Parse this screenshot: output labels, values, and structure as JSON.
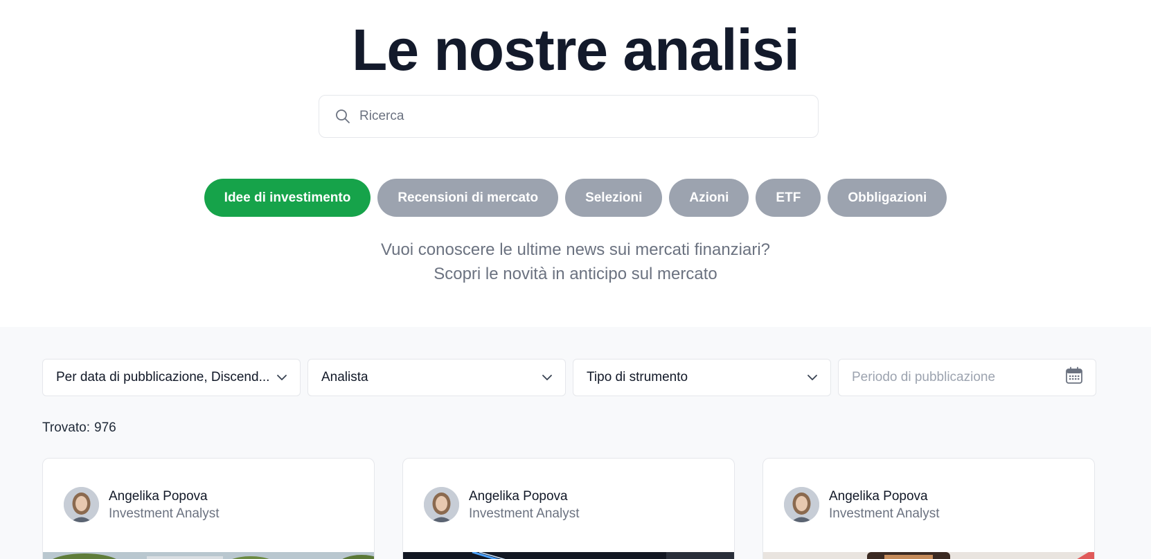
{
  "page": {
    "title": "Le nostre analisi",
    "search_placeholder": "Ricerca",
    "subtitle_line1": "Vuoi conoscere le ultime news sui mercati finanziari?",
    "subtitle_line2": "Scopri le novità in anticipo sul mercato"
  },
  "tabs": [
    {
      "label": "Idee di investimento",
      "active": true
    },
    {
      "label": "Recensioni di mercato",
      "active": false
    },
    {
      "label": "Selezioni",
      "active": false
    },
    {
      "label": "Azioni",
      "active": false
    },
    {
      "label": "ETF",
      "active": false
    },
    {
      "label": "Obbligazioni",
      "active": false
    }
  ],
  "filters": {
    "sort": "Per data di pubblicazione, Discend...",
    "analyst": "Analista",
    "instrument": "Tipo di strumento",
    "period_placeholder": "Periodo di pubblicazione"
  },
  "results": {
    "label": "Trovato:",
    "count": "976"
  },
  "cards": [
    {
      "author": "Angelika Popova",
      "role": "Investment Analyst"
    },
    {
      "author": "Angelika Popova",
      "role": "Investment Analyst"
    },
    {
      "author": "Angelika Popova",
      "role": "Investment Analyst"
    }
  ],
  "colors": {
    "accent": "#16a34a",
    "tab_inactive": "#9ca3af",
    "title": "#131a2b",
    "muted_text": "#6b7280",
    "content_bg": "#f8f9fb"
  },
  "icons": {
    "search": "search-icon",
    "dropdown": "chevron-down-icon",
    "calendar": "calendar-icon"
  }
}
